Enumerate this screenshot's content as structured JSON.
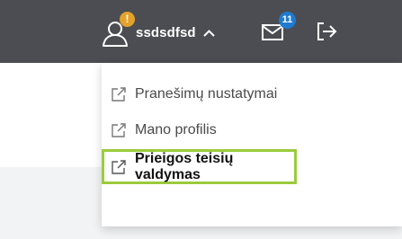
{
  "header": {
    "username": "ssdsdfsd",
    "alert_badge": "!",
    "messages_badge": "11",
    "colors": {
      "bar": "#4b4d52",
      "alert": "#e3a22a",
      "messages": "#1f7bd0"
    }
  },
  "menu": {
    "items": [
      {
        "label": "Pranešimų nustatymai",
        "icon": "external-link-icon"
      },
      {
        "label": "Mano profilis",
        "icon": "external-link-icon"
      },
      {
        "label": "Prieigos teisių valdymas",
        "icon": "external-link-icon",
        "highlighted": true
      }
    ],
    "highlight_color": "#9bcb3c"
  }
}
